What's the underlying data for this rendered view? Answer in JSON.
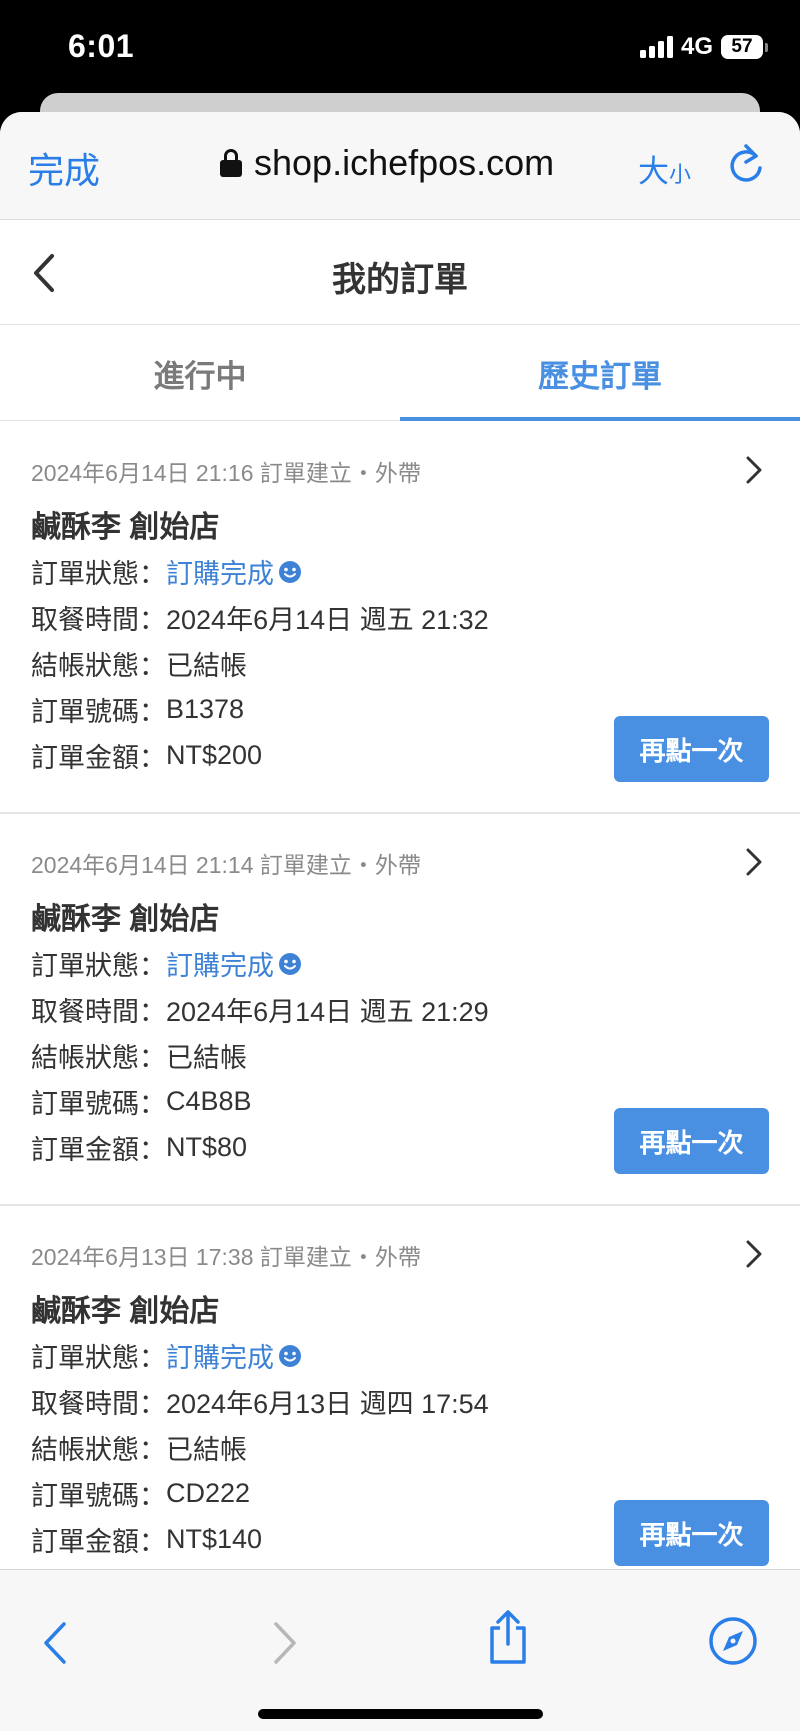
{
  "status_bar": {
    "time": "6:01",
    "network": "4G",
    "battery": "57"
  },
  "browser": {
    "done_label": "完成",
    "url": "shop.ichefpos.com",
    "text_size_big": "大",
    "text_size_small": "小"
  },
  "header": {
    "title": "我的訂單"
  },
  "tabs": [
    {
      "label": "進行中",
      "active": false
    },
    {
      "label": "歷史訂單",
      "active": true
    }
  ],
  "labels": {
    "status": "訂單狀態：",
    "pickup": "取餐時間：",
    "payment": "結帳狀態：",
    "number": "訂單號碼：",
    "amount": "訂單金額：",
    "reorder": "再點一次"
  },
  "orders": [
    {
      "meta": "2024年6月14日 21:16 訂單建立・外帶",
      "store": "鹹酥李 創始店",
      "status": "訂購完成",
      "pickup": "2024年6月14日 週五 21:32",
      "payment": "已結帳",
      "number": "B1378",
      "amount": "NT$200"
    },
    {
      "meta": "2024年6月14日 21:14 訂單建立・外帶",
      "store": "鹹酥李 創始店",
      "status": "訂購完成",
      "pickup": "2024年6月14日 週五 21:29",
      "payment": "已結帳",
      "number": "C4B8B",
      "amount": "NT$80"
    },
    {
      "meta": "2024年6月13日 17:38 訂單建立・外帶",
      "store": "鹹酥李 創始店",
      "status": "訂購完成",
      "pickup": "2024年6月13日 週四 17:54",
      "payment": "已結帳",
      "number": "CD222",
      "amount": "NT$140"
    }
  ],
  "colors": {
    "accent": "#4a90e2",
    "link": "#2a7ee8"
  }
}
